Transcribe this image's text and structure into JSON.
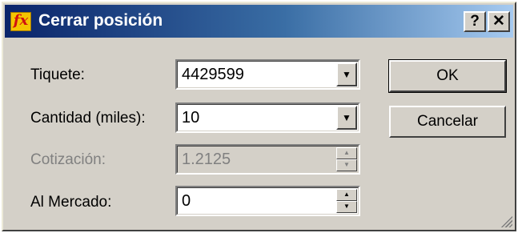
{
  "window": {
    "title": "Cerrar posición",
    "icon": "fx-icon",
    "help_label": "?",
    "close_label": "✕"
  },
  "form": {
    "ticket": {
      "label": "Tiquete:",
      "value": "4429599"
    },
    "quantity": {
      "label": "Cantidad (miles):",
      "value": "10"
    },
    "quote": {
      "label": "Cotización:",
      "value": "1.2125"
    },
    "market": {
      "label": "Al Mercado:",
      "value": "0"
    }
  },
  "buttons": {
    "ok_label": "OK",
    "cancel_label": "Cancelar"
  },
  "icons": {
    "dropdown": "▼",
    "spin_up": "▲",
    "spin_down": "▼",
    "app_icon_text": "fx"
  },
  "colors": {
    "title_gradient_start": "#0a246a",
    "title_gradient_end": "#a6caf0",
    "dialog_bg": "#d4d0c8",
    "disabled_text": "#808080"
  }
}
